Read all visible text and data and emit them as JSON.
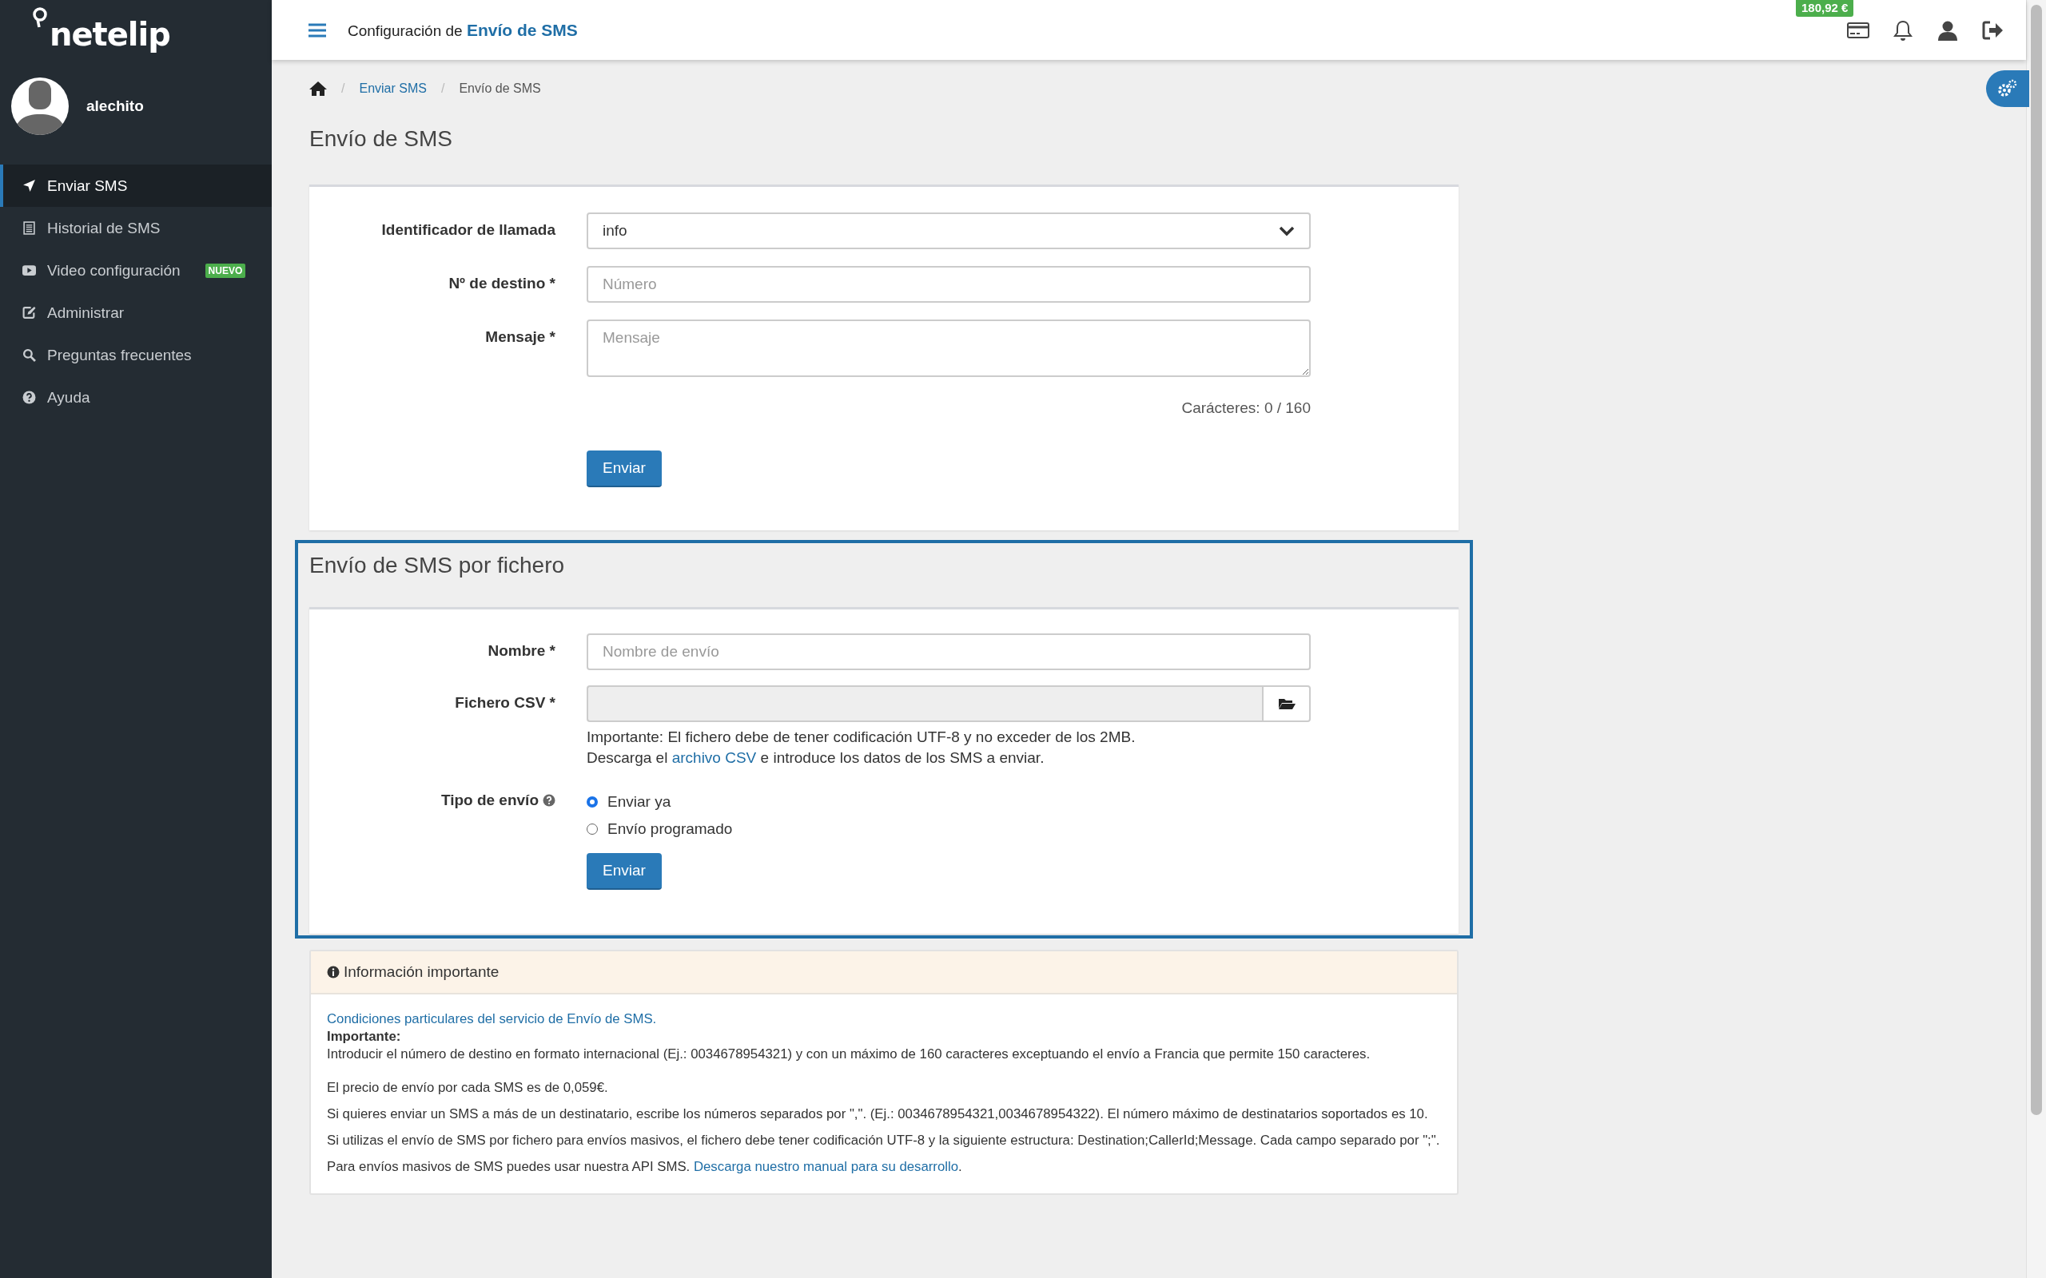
{
  "logo": {
    "text": "netelip"
  },
  "user": {
    "name": "alechito"
  },
  "sidebar": {
    "items": [
      {
        "label": "Enviar SMS",
        "selected": true
      },
      {
        "label": "Historial de SMS",
        "selected": false
      },
      {
        "label": "Video configuración",
        "selected": false,
        "badge": "NUEVO"
      },
      {
        "label": "Administrar",
        "selected": false
      },
      {
        "label": "Preguntas frecuentes",
        "selected": false
      },
      {
        "label": "Ayuda",
        "selected": false
      }
    ]
  },
  "header": {
    "title_prefix": "Configuración de",
    "title_highlight": "Envío de SMS",
    "balance": "180,92 €"
  },
  "breadcrumb": [
    {
      "separator": "/",
      "label": "Enviar SMS",
      "link": true
    },
    {
      "separator": "/",
      "label": "Envío de SMS",
      "link": false
    }
  ],
  "page_title": "Envío de SMS",
  "sms_form": {
    "fields": [
      {
        "kind": "select",
        "label": "Identificador de llamada",
        "value": "info"
      },
      {
        "kind": "input",
        "label": "Nº de destino *",
        "placeholder": "Número"
      },
      {
        "kind": "textarea",
        "label": "Mensaje *",
        "placeholder": "Mensaje"
      }
    ],
    "counter": "Carácteres: 0 / 160",
    "button": "Enviar"
  },
  "file_form": {
    "title": "Envío de SMS por fichero",
    "highlighted": true,
    "name_field": {
      "label": "Nombre *",
      "placeholder": "Nombre de envío"
    },
    "file_field": {
      "label": "Fichero CSV *"
    },
    "help": {
      "line1": "Importante: El fichero debe de tener codificación UTF-8 y no exceder de los 2MB.",
      "before": "Descarga el",
      "link": "archivo CSV",
      "after": "e introduce los datos de los SMS a enviar."
    },
    "send_type": {
      "label": "Tipo de envío",
      "options": [
        {
          "label": "Enviar ya",
          "selected": true
        },
        {
          "label": "Envío programado",
          "selected": false
        }
      ]
    },
    "button": "Enviar"
  },
  "info": {
    "title": "Información importante",
    "conditions_link": "Condiciones particulares del servicio de Envío de SMS.",
    "important_label": "Importante:",
    "important_text": "Introducir el número de destino en formato internacional (Ej.: 0034678954321) y con un máximo de 160 caracteres exceptuando el envío a Francia que permite 150 caracteres.",
    "paragraphs": [
      "El precio de envío por cada SMS es de 0,059€.",
      "Si quieres enviar un SMS a más de un destinatario, escribe los números separados por \",\". (Ej.: 0034678954321,0034678954322). El número máximo de destinatarios soportados es 10.",
      "Si utilizas el envío de SMS por fichero para envíos masivos, el fichero debe tener codificación UTF-8 y la siguiente estructura: Destination;CallerId;Message. Cada campo separado por \";\"."
    ],
    "api": {
      "text": "Para envíos masivos de SMS puedes usar nuestra API SMS.",
      "link": "Descarga nuestro manual para su desarrollo",
      "after": "."
    }
  }
}
